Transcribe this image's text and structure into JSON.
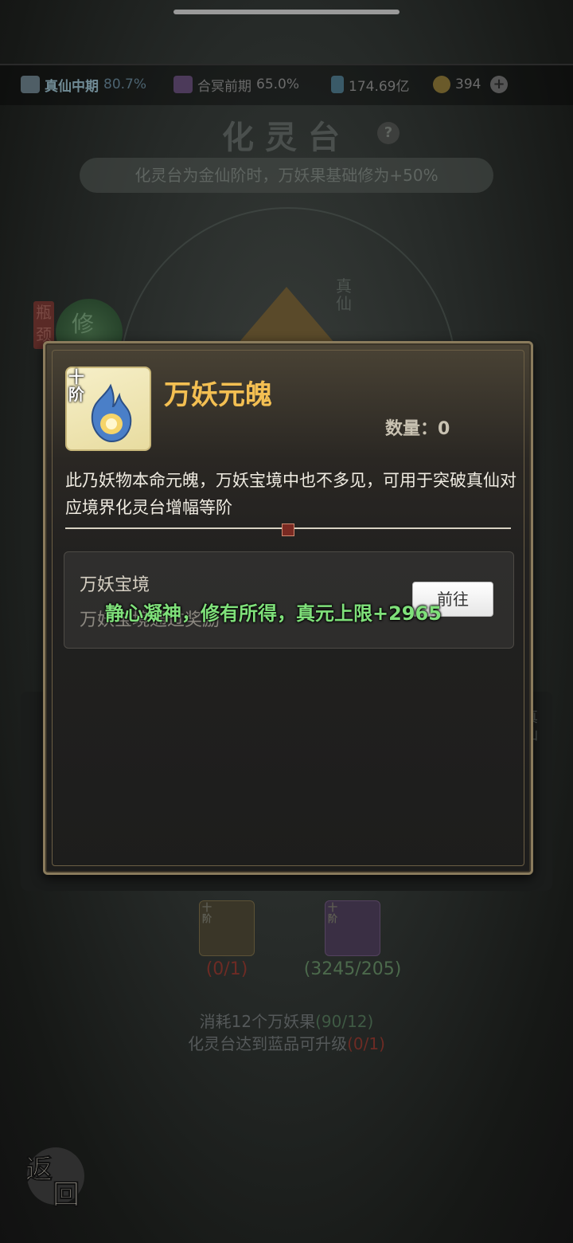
{
  "status_bar": {
    "realm": {
      "name": "真仙中期",
      "percent": "80.7%"
    },
    "sub_realm": {
      "name": "合冥前期",
      "percent": "65.0%"
    },
    "spirit_stones": "174.69亿",
    "gems": "394",
    "plus_label": "+"
  },
  "page": {
    "title": "化灵台",
    "help_label": "?",
    "banner": "化灵台为金仙阶时，万妖果基础修为+50%",
    "bg_label_zhenxian": "真仙",
    "bg_badge": "瓶颈",
    "bg_orb_text": "修",
    "bg_label_right": "真仙"
  },
  "materials": [
    {
      "tier": "十阶",
      "count": "(0/1)",
      "count_color": "#6d2b24"
    },
    {
      "tier": "十阶",
      "count": "(3245/205)",
      "count_color": "#4c6a4c"
    }
  ],
  "requirements": {
    "line1_text": "消耗12个万妖果",
    "line1_progress": "(90/12)",
    "line2_text": "化灵台达到蓝品可升级",
    "line2_progress": "(0/1)"
  },
  "back_button": {
    "char1": "返",
    "char2": "回"
  },
  "modal": {
    "tier": "十阶",
    "item_name": "万妖元魄",
    "quantity_label": "数量：",
    "quantity_value": "0",
    "description": "此乃妖物本命元魄，万妖宝境中也不多见，可用于突破真仙对应境界化灵台增幅等阶",
    "source": {
      "title": "万妖宝境",
      "subtitle": "万妖宝境通过奖励",
      "goto_label": "前往"
    }
  },
  "toast": "静心凝神，修有所得，真元上限+2965",
  "colors": {
    "accent_gold": "#f3bf52",
    "toast_green": "#7fe07a",
    "progress_red": "#6d2b24",
    "progress_green": "#4c6a4c"
  }
}
